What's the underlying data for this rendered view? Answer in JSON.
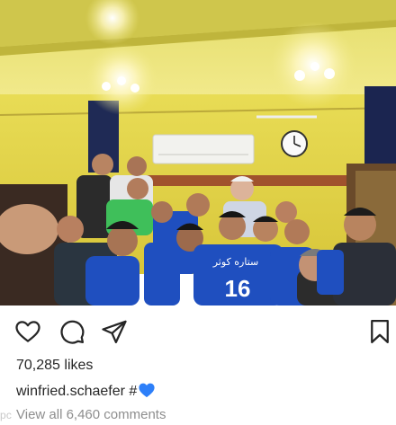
{
  "post": {
    "likes_text": "70,285 likes",
    "username": "winfried.schaefer",
    "caption_text": "#",
    "caption_emoji": "blue-heart-icon",
    "comments_link": "View all 6,460 comments",
    "watermark": "pc"
  },
  "photo": {
    "jersey_number": "16",
    "jersey_sponsor": "ستاره کوثر"
  },
  "icons": {
    "like": "heart-outline-icon",
    "comment": "comment-bubble-icon",
    "share": "paper-plane-icon",
    "save": "bookmark-icon"
  },
  "colors": {
    "wall": "#e7d94a",
    "ceiling": "#f3eb8a",
    "jersey": "#1f4fbf",
    "text_primary": "#262626",
    "text_secondary": "#8e8e8e",
    "heart_blue": "#2d7ff9"
  }
}
